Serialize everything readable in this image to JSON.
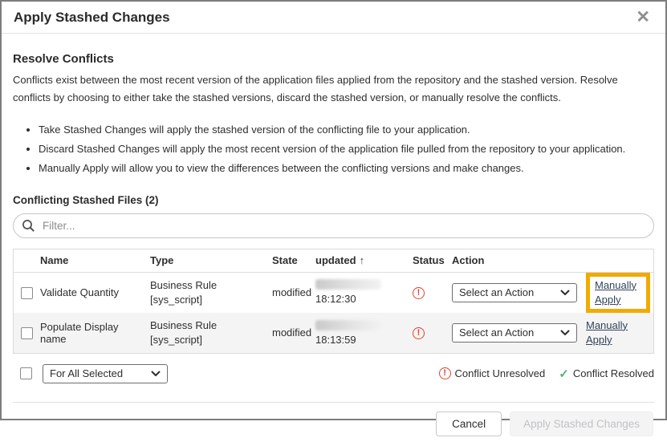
{
  "dialog": {
    "title": "Apply Stashed Changes",
    "close_glyph": "✕"
  },
  "resolve": {
    "heading": "Resolve Conflicts",
    "description": "Conflicts exist between the most recent version of the application files applied from the repository and the stashed version. Resolve conflicts by choosing to either take the stashed versions, discard the stashed version, or manually resolve the conflicts.",
    "bullets": [
      "Take Stashed Changes will apply the stashed version of the conflicting file to your application.",
      "Discard Stashed Changes will apply the most recent version of the application file pulled from the repository to your application.",
      "Manually Apply will allow you to view the differences between the conflicting versions and make changes."
    ]
  },
  "files_section": {
    "heading": "Conflicting Stashed Files (2)",
    "filter_placeholder": "Filter..."
  },
  "table": {
    "headers": {
      "name": "Name",
      "type": "Type",
      "state": "State",
      "updated": "updated",
      "sort_arrow": "↑",
      "status": "Status",
      "action": "Action"
    },
    "rows": [
      {
        "name": "Validate Quantity",
        "type_line1": "Business Rule",
        "type_line2": "[sys_script]",
        "state": "modified",
        "updated_time": "18:12:30",
        "status_glyph": "!",
        "action_select": "Select an Action",
        "link": "Manually Apply"
      },
      {
        "name": "Populate Display name",
        "type_line1": "Business Rule",
        "type_line2": "[sys_script]",
        "state": "modified",
        "updated_time": "18:13:59",
        "status_glyph": "!",
        "action_select": "Select an Action",
        "link": "Manually Apply"
      }
    ]
  },
  "bottom": {
    "bulk_select_label": "For All Selected",
    "legend_unresolved_glyph": "!",
    "legend_unresolved": "Conflict Unresolved",
    "legend_resolved_glyph": "✓",
    "legend_resolved": "Conflict Resolved"
  },
  "footer": {
    "cancel_label": "Cancel",
    "apply_label": "Apply Stashed Changes"
  },
  "colors": {
    "highlight_gold": "#f0ab00",
    "status_red": "#e0432e",
    "success_green": "#56b26a"
  }
}
